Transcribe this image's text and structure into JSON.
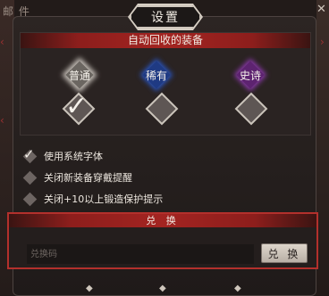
{
  "background": {
    "mail_label": "邮 件"
  },
  "dialog": {
    "title": "设置",
    "close_symbol": "✕"
  },
  "auto_recycle": {
    "heading": "自动回收的装备",
    "rarities": [
      {
        "label": "普通",
        "checked": true,
        "color": "#6b6661"
      },
      {
        "label": "稀有",
        "checked": false,
        "color": "#1f3a83"
      },
      {
        "label": "史诗",
        "checked": false,
        "color": "#5d2370"
      }
    ]
  },
  "options": [
    {
      "label": "使用系统字体",
      "checked": true
    },
    {
      "label": "关闭新装备穿戴提醒",
      "checked": false
    },
    {
      "label": "关闭+10以上锻造保护提示",
      "checked": false
    }
  ],
  "redeem": {
    "heading": "兑 换",
    "input_placeholder": "兑换码",
    "button_label": "兑 换"
  },
  "colors": {
    "accent_red": "#a32421",
    "border_red": "#b3302c"
  }
}
